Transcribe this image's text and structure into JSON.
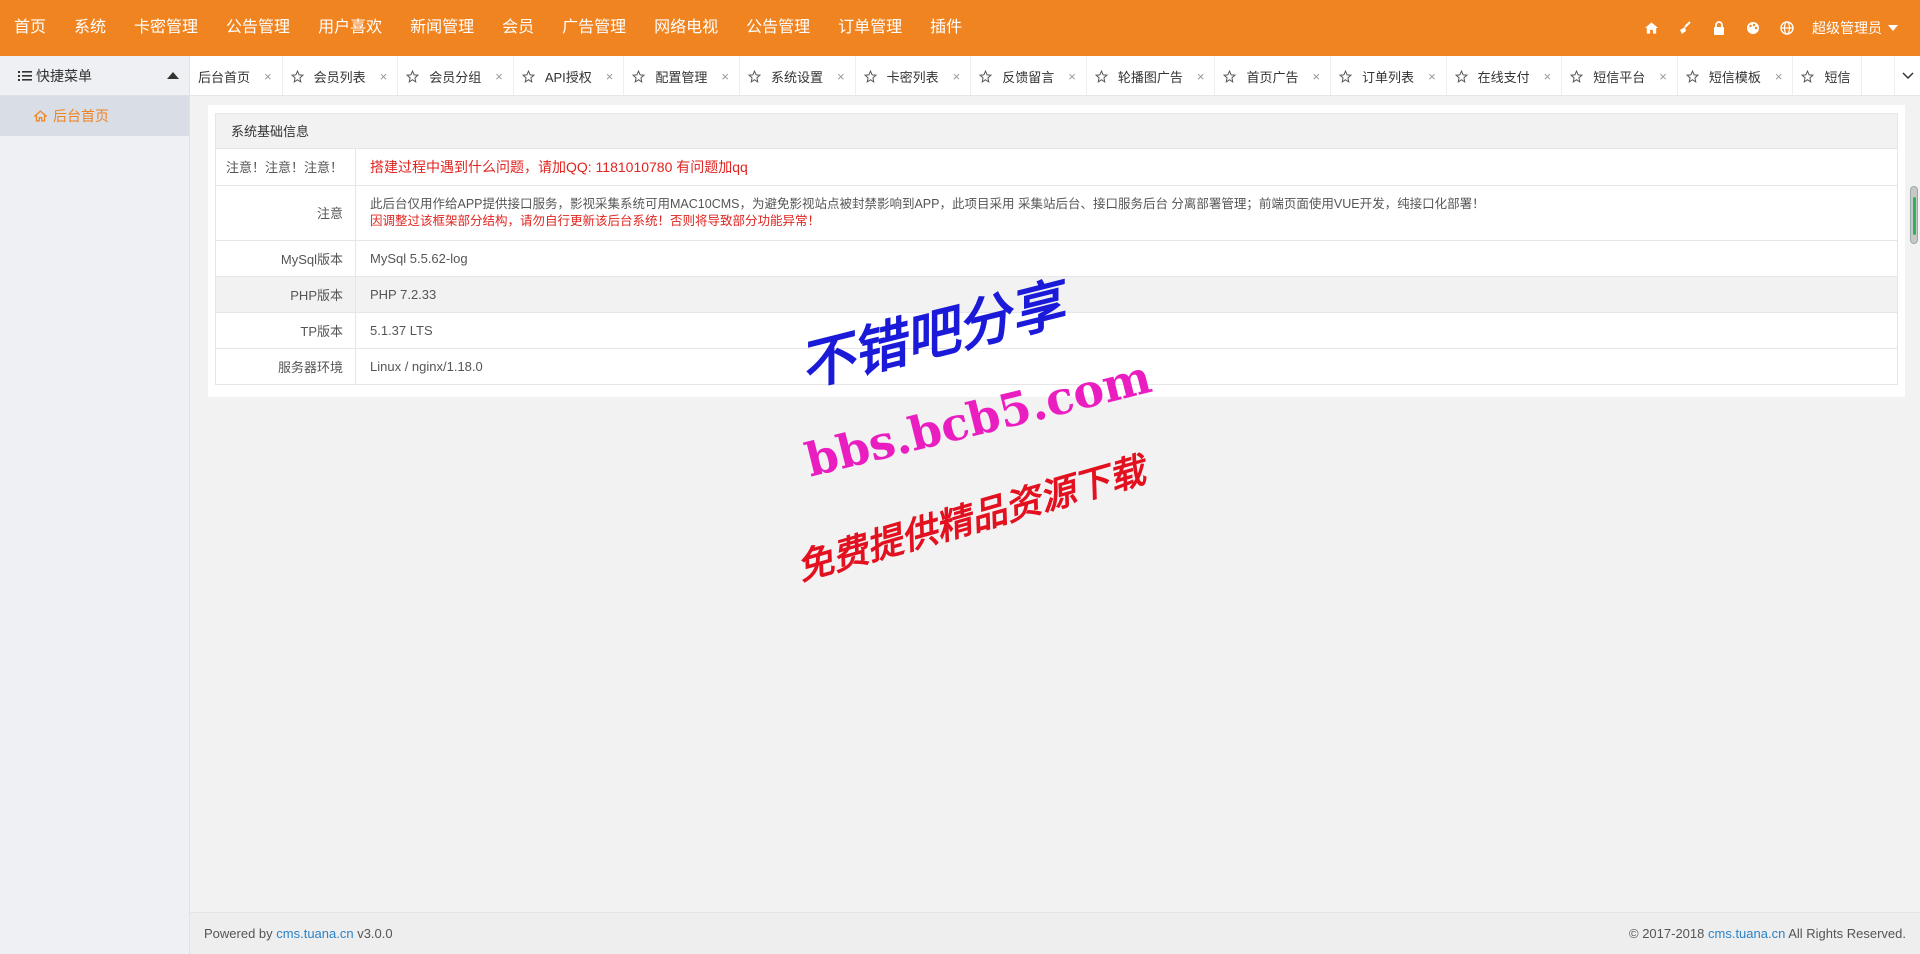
{
  "header": {
    "nav": [
      "首页",
      "系统",
      "卡密管理",
      "公告管理",
      "用户喜欢",
      "新闻管理",
      "会员",
      "广告管理",
      "网络电视",
      "公告管理",
      "订单管理",
      "插件"
    ],
    "admin_label": "超级管理员",
    "icons": [
      "home-icon",
      "broom-icon",
      "lock-icon",
      "palette-icon",
      "globe-icon"
    ]
  },
  "sidebar": {
    "title": "快捷菜单",
    "items": [
      {
        "label": "后台首页",
        "icon": "home-icon"
      }
    ]
  },
  "tabs": {
    "home": "后台首页",
    "items": [
      "会员列表",
      "会员分组",
      "API授权",
      "配置管理",
      "系统设置",
      "卡密列表",
      "反馈留言",
      "轮播图广告",
      "首页广告",
      "订单列表",
      "在线支付",
      "短信平台",
      "短信模板",
      "短信"
    ],
    "close": "×"
  },
  "panel": {
    "title": "系统基础信息",
    "notice_key": "注意！注意！注意！",
    "notice_value": "搭建过程中遇到什么问题，请加QQ: 1181010780 有问题加qq",
    "note_key": "注意",
    "note_line1": "此后台仅用作给APP提供接口服务，影视采集系统可用MAC10CMS，为避免影视站点被封禁影响到APP，此项目采用 采集站后台、接口服务后台 分离部署管理；前端页面使用VUE开发，纯接口化部署！",
    "note_line2": "因调整过该框架部分结构，请勿自行更新该后台系统！否则将导致部分功能异常！",
    "rows": [
      {
        "key": "MySql版本",
        "value": "MySql 5.5.62-log"
      },
      {
        "key": "PHP版本",
        "value": "PHP 7.2.33"
      },
      {
        "key": "TP版本",
        "value": "5.1.37 LTS"
      },
      {
        "key": "服务器环境",
        "value": "Linux / nginx/1.18.0"
      }
    ]
  },
  "footer": {
    "powered_prefix": "Powered by ",
    "powered_link": "cms.tuana.cn",
    "powered_version": " v3.0.0",
    "copy_prefix": "© 2017-2018 ",
    "copy_link": "cms.tuana.cn",
    "copy_suffix": " All Rights Reserved."
  },
  "watermark": {
    "line1": "不错吧分享",
    "line2": "bbs.bcb5.com",
    "line3": "免费提供精品资源下载"
  },
  "colors": {
    "header_bg": "#f08420",
    "accent": "#f08420",
    "notice_red": "#e0241f",
    "link_blue": "#2a83c7"
  }
}
